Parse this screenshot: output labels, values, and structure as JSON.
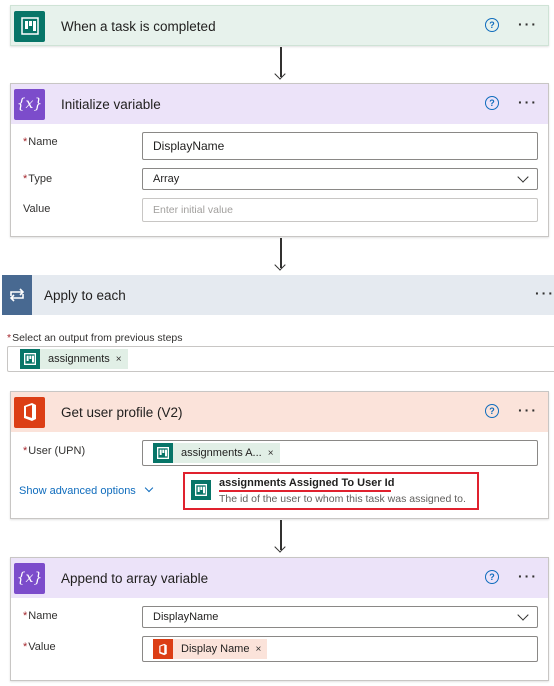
{
  "trigger": {
    "title": "When a task is completed",
    "help": "?",
    "more": "···"
  },
  "init_var": {
    "title": "Initialize variable",
    "help": "?",
    "more": "···",
    "icon_text": "{x}",
    "name_label": "Name",
    "name_value": "DisplayName",
    "type_label": "Type",
    "type_value": "Array",
    "value_label": "Value",
    "value_placeholder": "Enter initial value"
  },
  "apply_each": {
    "title": "Apply to each",
    "more": "···",
    "select_label": "Select an output from previous steps",
    "token": "assignments",
    "token_remove": "×"
  },
  "get_user": {
    "title": "Get user profile (V2)",
    "help": "?",
    "more": "···",
    "user_label": "User (UPN)",
    "token": "assignments A...",
    "token_remove": "×",
    "advanced": "Show advanced options",
    "tooltip_title": "assignments Assigned To User Id",
    "tooltip_desc": "The id of the user to whom this task was assigned to."
  },
  "append": {
    "title": "Append to array variable",
    "help": "?",
    "more": "···",
    "icon_text": "{x}",
    "name_label": "Name",
    "name_value": "DisplayName",
    "value_label": "Value",
    "value_token": "Display Name",
    "token_remove": "×"
  },
  "required_mark": "*",
  "colors": {
    "planner_green": "#077568",
    "variable_purple": "#7c4ccb",
    "loop_blue": "#486991",
    "office_orange": "#dc3e15",
    "highlight_red": "#e0212e"
  }
}
